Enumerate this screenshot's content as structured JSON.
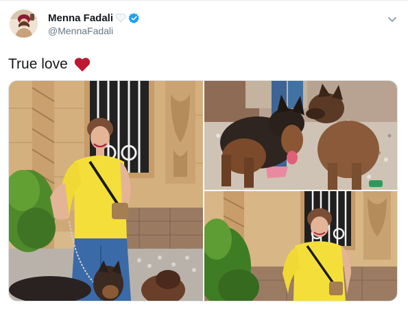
{
  "tweet": {
    "author": {
      "display_name": "Menna Fadali",
      "handle": "@MennaFadali",
      "verified": true,
      "name_emoji": "white-heart-icon"
    },
    "text": "True love",
    "text_emoji": "red-heart-icon",
    "menu_icon": "chevron-down-icon",
    "photos": [
      {
        "icon": "photo-woman-with-dogs"
      },
      {
        "icon": "photo-two-german-shepherds"
      },
      {
        "icon": "photo-woman-by-window"
      }
    ]
  },
  "colors": {
    "verified_blue": "#1da1f2",
    "handle_gray": "#657786",
    "text_dark": "#14171a",
    "heart_red": "#be1931",
    "divider": "#e6ecf0"
  }
}
